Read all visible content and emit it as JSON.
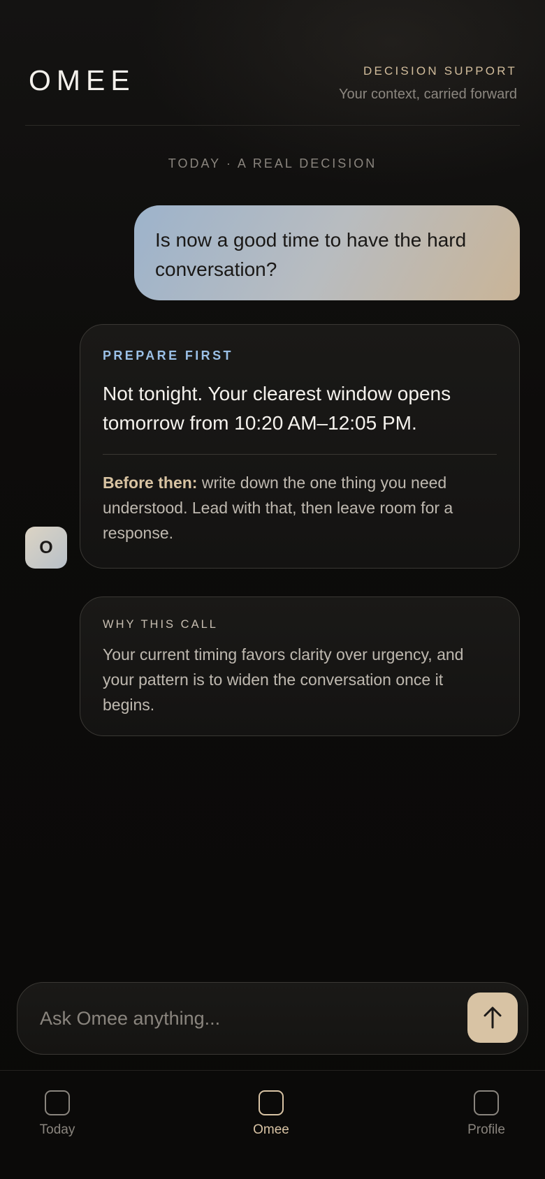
{
  "header": {
    "brand": "OMEE",
    "eyebrow": "DECISION SUPPORT",
    "tagline": "Your context, carried forward"
  },
  "conversation": {
    "date_label": "TODAY · A REAL DECISION",
    "user_message": "Is now a good time to have the hard conversation?",
    "avatar_initial": "O",
    "recommendation": {
      "label": "PREPARE FIRST",
      "headline": "Not tonight. Your clearest window opens tomorrow from 10:20 AM–12:05 PM.",
      "body_lead": "Before then:",
      "body_text": " write down the one thing you need understood. Lead with that, then leave room for a response."
    },
    "why": {
      "label": "WHY THIS CALL",
      "body": "Your current timing favors clarity over urgency, and your pattern is to widen the conversation once it begins."
    }
  },
  "composer": {
    "placeholder": "Ask Omee anything...",
    "value": ""
  },
  "nav": {
    "items": [
      {
        "label": "Today",
        "icon": "square-icon",
        "active": false
      },
      {
        "label": "Omee",
        "icon": "square-icon",
        "active": true
      },
      {
        "label": "Profile",
        "icon": "square-icon",
        "active": false
      }
    ]
  },
  "colors": {
    "accent": "#d8c3a4",
    "label_blue": "#9bc0e6",
    "background": "#0b0a09"
  }
}
